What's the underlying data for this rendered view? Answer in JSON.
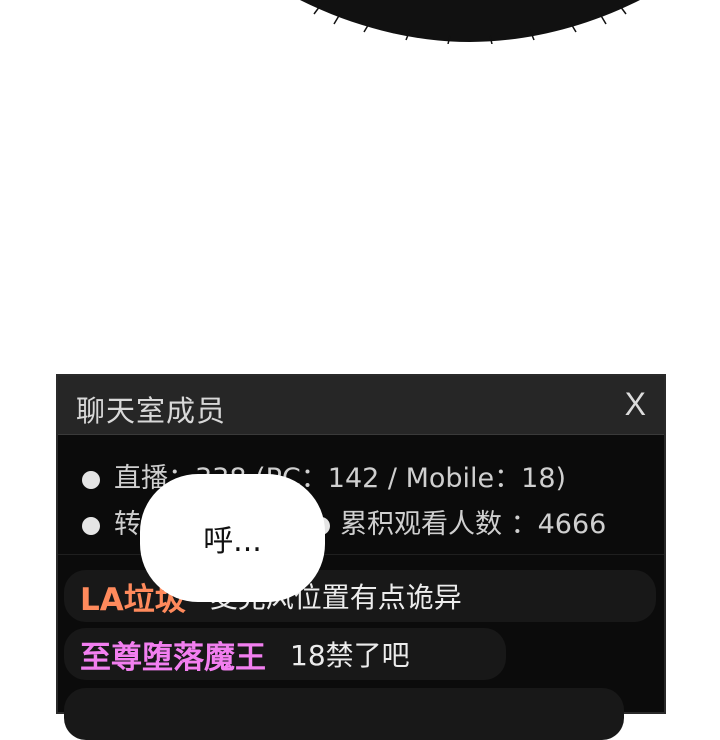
{
  "panel": {
    "title": "聊天室成员",
    "close_label": "X",
    "stats": {
      "live_label": "直播：338 (PC：142 / Mobile：18)",
      "relay_label": "转",
      "cumulative_label": "累积观看人数 ：4666"
    }
  },
  "chat": [
    {
      "username": "LA垃圾",
      "message": "麦克风位置有点诡异"
    },
    {
      "username": "至尊堕落魔王",
      "message": "18禁了吧"
    }
  ],
  "speech_bubble": {
    "text": "呼..."
  },
  "colors": {
    "panel_bg": "#0b0b0b",
    "header_bg": "#262626",
    "username_orange": "#ff8a5c",
    "username_pink": "#f27ff0"
  }
}
